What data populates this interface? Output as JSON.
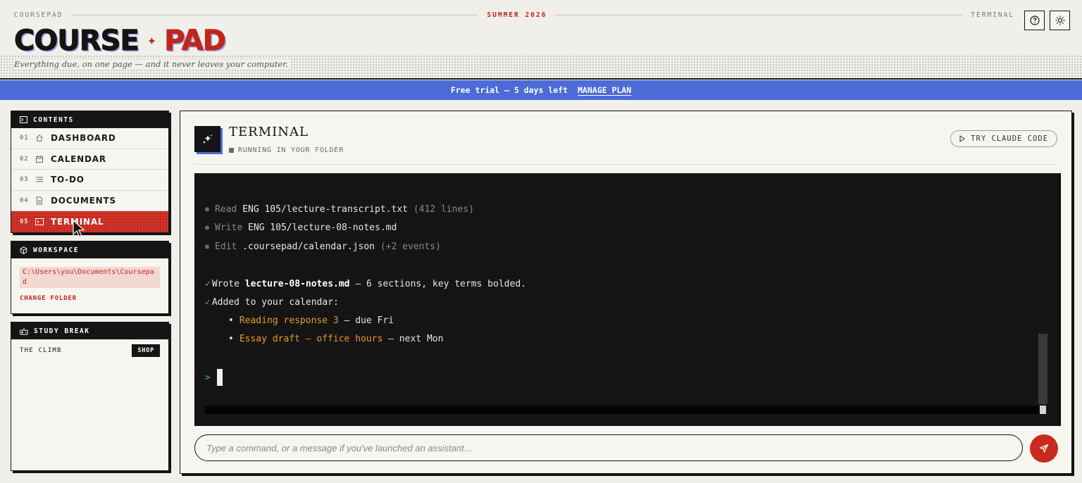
{
  "header": {
    "brand_small": "COURSEPAD",
    "season": "SUMMER 2026",
    "section": "TERMINAL",
    "logo_word1": "COURSE",
    "logo_sep": "✦",
    "logo_word2": "PAD",
    "tagline": "Everything due, on one page — and it never leaves your computer.",
    "help_icon": "help-circle-icon",
    "theme_icon": "sun-icon"
  },
  "banner": {
    "text": "Free trial — 5 days left",
    "action": "MANAGE PLAN"
  },
  "sidebar": {
    "contents_title": "CONTENTS",
    "items": [
      {
        "num": "01",
        "label": "DASHBOARD",
        "icon": "home-icon"
      },
      {
        "num": "02",
        "label": "CALENDAR",
        "icon": "calendar-icon"
      },
      {
        "num": "03",
        "label": "TO-DO",
        "icon": "list-icon"
      },
      {
        "num": "04",
        "label": "DOCUMENTS",
        "icon": "document-icon"
      },
      {
        "num": "05",
        "label": "TERMINAL",
        "icon": "terminal-icon",
        "active": true
      }
    ],
    "workspace_title": "WORKSPACE",
    "workspace_path": "C:\\Users\\you\\Documents\\Coursepad",
    "change_folder": "CHANGE FOLDER",
    "study_title": "STUDY BREAK",
    "study_game": "THE CLIMB",
    "shop_label": "SHOP"
  },
  "main": {
    "title": "TERMINAL",
    "status": "RUNNING IN YOUR FOLDER",
    "try_button": "TRY CLAUDE CODE",
    "terminal_lines": {
      "l1_verb": "Read",
      "l1_path": "ENG 105/lecture-transcript.txt",
      "l1_meta": "(412 lines)",
      "l2_verb": "Write",
      "l2_path": "ENG 105/lecture-08-notes.md",
      "l3_verb": "Edit",
      "l3_path": ".coursepad/calendar.json",
      "l3_meta": "(+2 events)",
      "l4_a": "Wrote ",
      "l4_file": "lecture-08-notes.md",
      "l4_b": " — 6 sections, key terms bolded.",
      "l5": "Added to your calendar:",
      "l6_item": "Reading response 3",
      "l6_due": " — due Fri",
      "l7_item": "Essay draft — office hours",
      "l7_due": " — next Mon",
      "prompt": ">"
    },
    "input_placeholder": "Type a command, or a message if you've launched an assistant...",
    "colors": {
      "accent_red": "#c82a20",
      "banner_blue": "#4c6bd6",
      "ok_green": "#33c774",
      "amber": "#e59a2d"
    }
  }
}
